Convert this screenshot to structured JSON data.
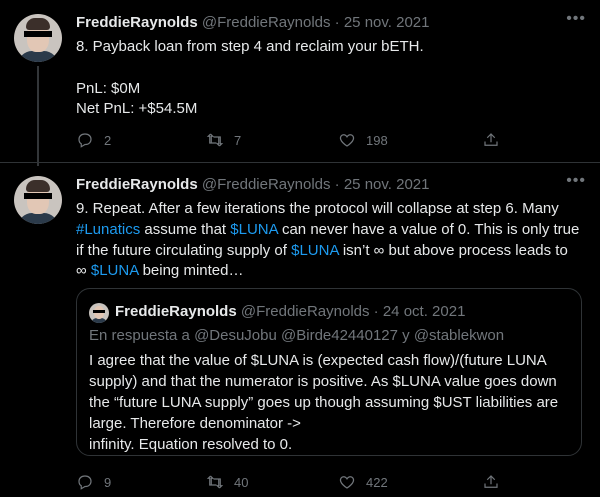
{
  "tweets": [
    {
      "author_name": "FreddieRaynolds",
      "handle": "@FreddieRaynolds",
      "separator": "·",
      "date": "25 nov. 2021",
      "lines": [
        "8. Payback loan from step 4 and reclaim your bETH.",
        "",
        "PnL: $0M",
        "Net PnL: +$54.5M"
      ],
      "replies": "2",
      "retweets": "7",
      "likes": "198"
    },
    {
      "author_name": "FreddieRaynolds",
      "handle": "@FreddieRaynolds",
      "separator": "·",
      "date": "25 nov. 2021",
      "line1": "9. Repeat. After a few iterations the protocol will collapse at step 6. Many",
      "line2_hashtag": "#Lunatics",
      "line2_mid": " assume that ",
      "line2_cashtag": "$LUNA",
      "line2_end": " can never have a value of 0. This is only true",
      "line3_start": "if the future circulating supply of ",
      "line3_cashtag": "$LUNA",
      "line3_end": " isn’t ∞ but above process leads to",
      "line4_start": "∞ ",
      "line4_cashtag": "$LUNA",
      "line4_end": " being minted…",
      "quote": {
        "author_name": "FreddieRaynolds",
        "handle": "@FreddieRaynolds",
        "separator": "·",
        "date": "24 oct. 2021",
        "reply_to": "En respuesta a @DesuJobu @Birde42440127 y @stablekwon",
        "lines": [
          "I agree that the value of $LUNA is (expected cash flow)/(future LUNA",
          "supply) and that the numerator is positive. As $LUNA value goes down",
          "the “future LUNA supply” goes up though assuming $UST liabilities are",
          "large. Therefore denominator ->",
          "infinity. Equation resolved to 0."
        ]
      },
      "replies": "9",
      "retweets": "40",
      "likes": "422"
    }
  ],
  "icons": {
    "more": "more-dots-icon",
    "reply": "reply-icon",
    "retweet": "retweet-icon",
    "like": "heart-icon",
    "share": "share-icon"
  },
  "colors": {
    "background": "#000000",
    "text": "#e7e9ea",
    "muted": "#71767b",
    "link": "#1d9bf0",
    "border": "#2f3336"
  }
}
